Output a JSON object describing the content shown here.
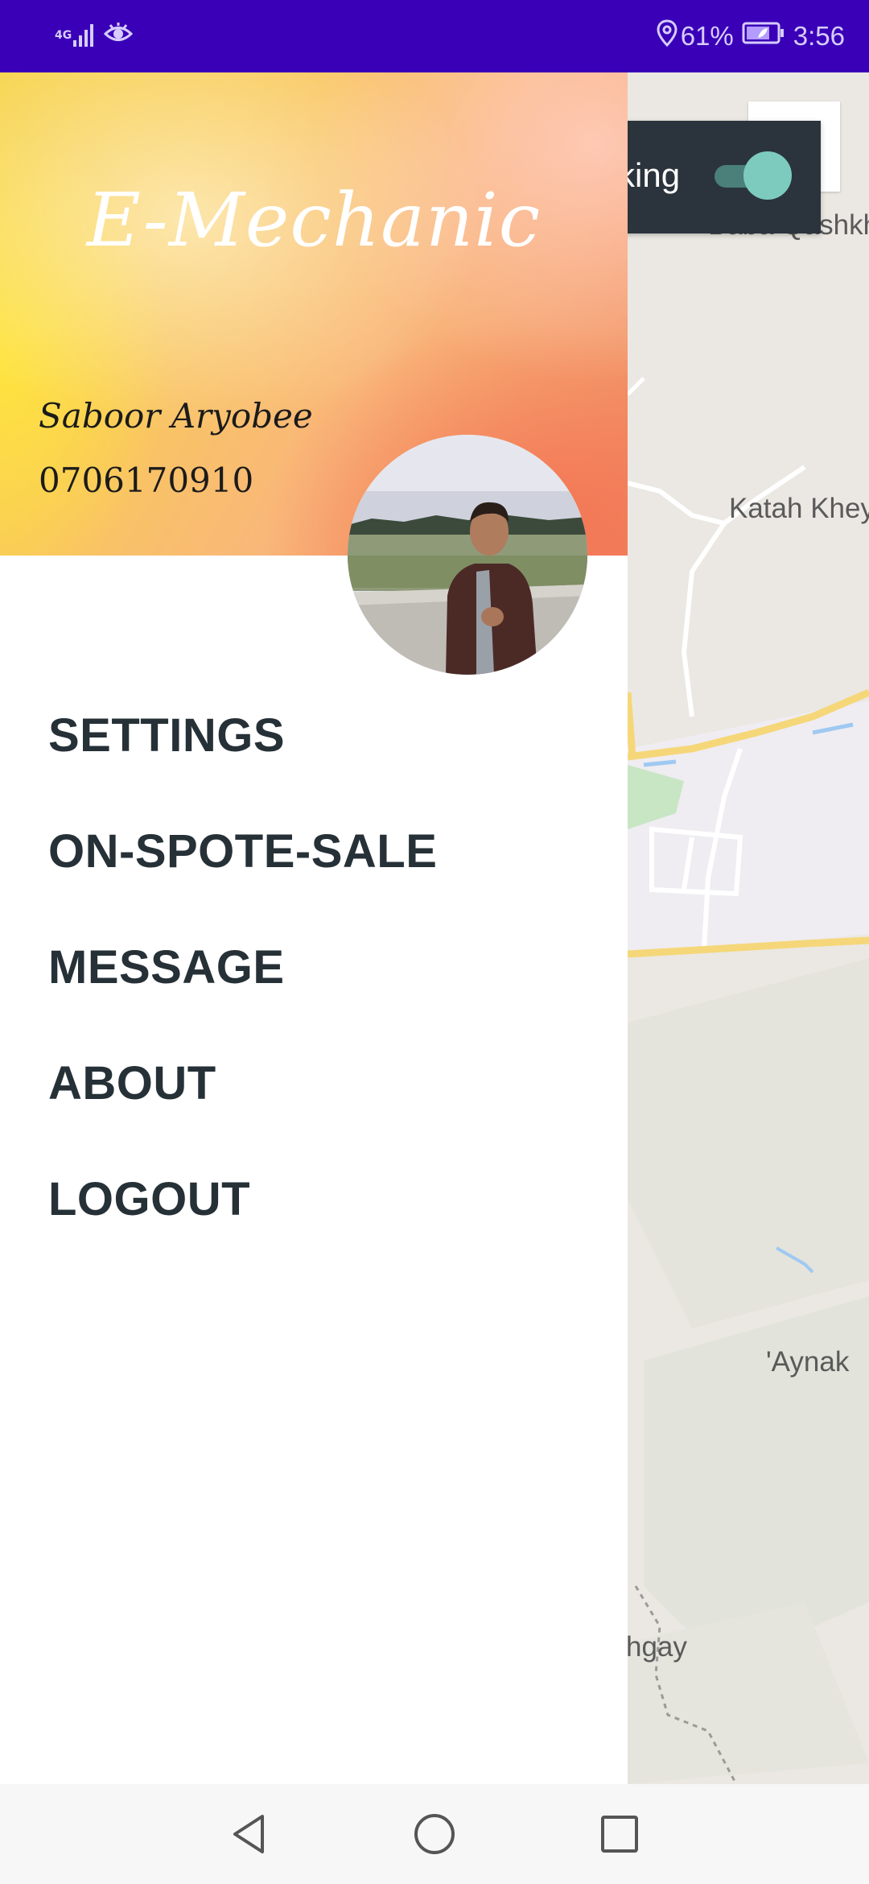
{
  "status_bar": {
    "network": "4G",
    "battery": "61%",
    "time": "3:56"
  },
  "drawer": {
    "app_title": "E-Mechanic",
    "user_name": "Saboor Aryobee",
    "user_phone": "0706170910",
    "menu": [
      {
        "label": "SETTINGS"
      },
      {
        "label": "ON-SPOTE-SALE"
      },
      {
        "label": "MESSAGE"
      },
      {
        "label": "ABOUT"
      },
      {
        "label": "LOGOUT"
      }
    ]
  },
  "tracking_card": {
    "label": "king",
    "enabled": true
  },
  "map": {
    "labels": [
      "Baba Qashkh",
      "Katah Khey",
      "'Aynak",
      "hgay"
    ]
  },
  "colors": {
    "status_bar": "#3a00b7",
    "menu_text": "#263037",
    "toggle_thumb": "#7dcbbe",
    "card_bg": "#2b343c",
    "map_bg": "#ebe8e3"
  },
  "icons": [
    "signal-icon",
    "eye-icon",
    "location-icon",
    "battery-icon",
    "back-icon",
    "home-icon",
    "recents-icon"
  ]
}
